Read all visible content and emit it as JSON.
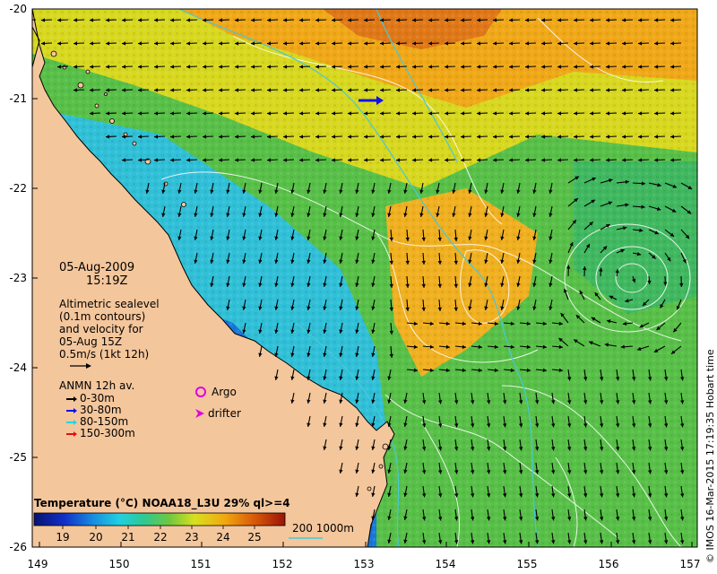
{
  "info": {
    "date": "05-Aug-2009",
    "time": "15:19Z",
    "altimetry_lines": [
      "Altimetric sealevel",
      "(0.1m contours)",
      "and velocity for",
      "05-Aug 15Z"
    ],
    "arrow_scale_label": "0.5m/s (1kt 12h)"
  },
  "anmn_legend": {
    "title": "ANMN 12h av.",
    "items": [
      {
        "label": "0-30m",
        "color": "#000000"
      },
      {
        "label": "30-80m",
        "color": "#1010ee"
      },
      {
        "label": "80-150m",
        "color": "#20d8e0"
      },
      {
        "label": "150-300m",
        "color": "#e01010"
      }
    ]
  },
  "markers": {
    "argo_label": "Argo",
    "argo_color": "#e000e0",
    "drifter_label": "drifter",
    "drifter_color": "#e000e0"
  },
  "colorbar": {
    "title": "Temperature (°C) NOAA18_L3U 29% ql>=4",
    "ticks": [
      "19",
      "20",
      "21",
      "22",
      "23",
      "24",
      "25"
    ]
  },
  "bathymetry": {
    "label": "200  1000m",
    "color": "#48c8d8"
  },
  "axes": {
    "lat_ticks": [
      "-20",
      "-21",
      "-22",
      "-23",
      "-24",
      "-25",
      "-26"
    ],
    "lon_ticks": [
      "149",
      "150",
      "151",
      "152",
      "153",
      "154",
      "155",
      "156",
      "157"
    ]
  },
  "credit": "© IMOS 16-Mar-2015 17:19:35 Hobart time",
  "colors": {
    "land": "#f4c69c",
    "ocean_warm": "#f0a010",
    "ocean_cold": "#0a1890"
  }
}
